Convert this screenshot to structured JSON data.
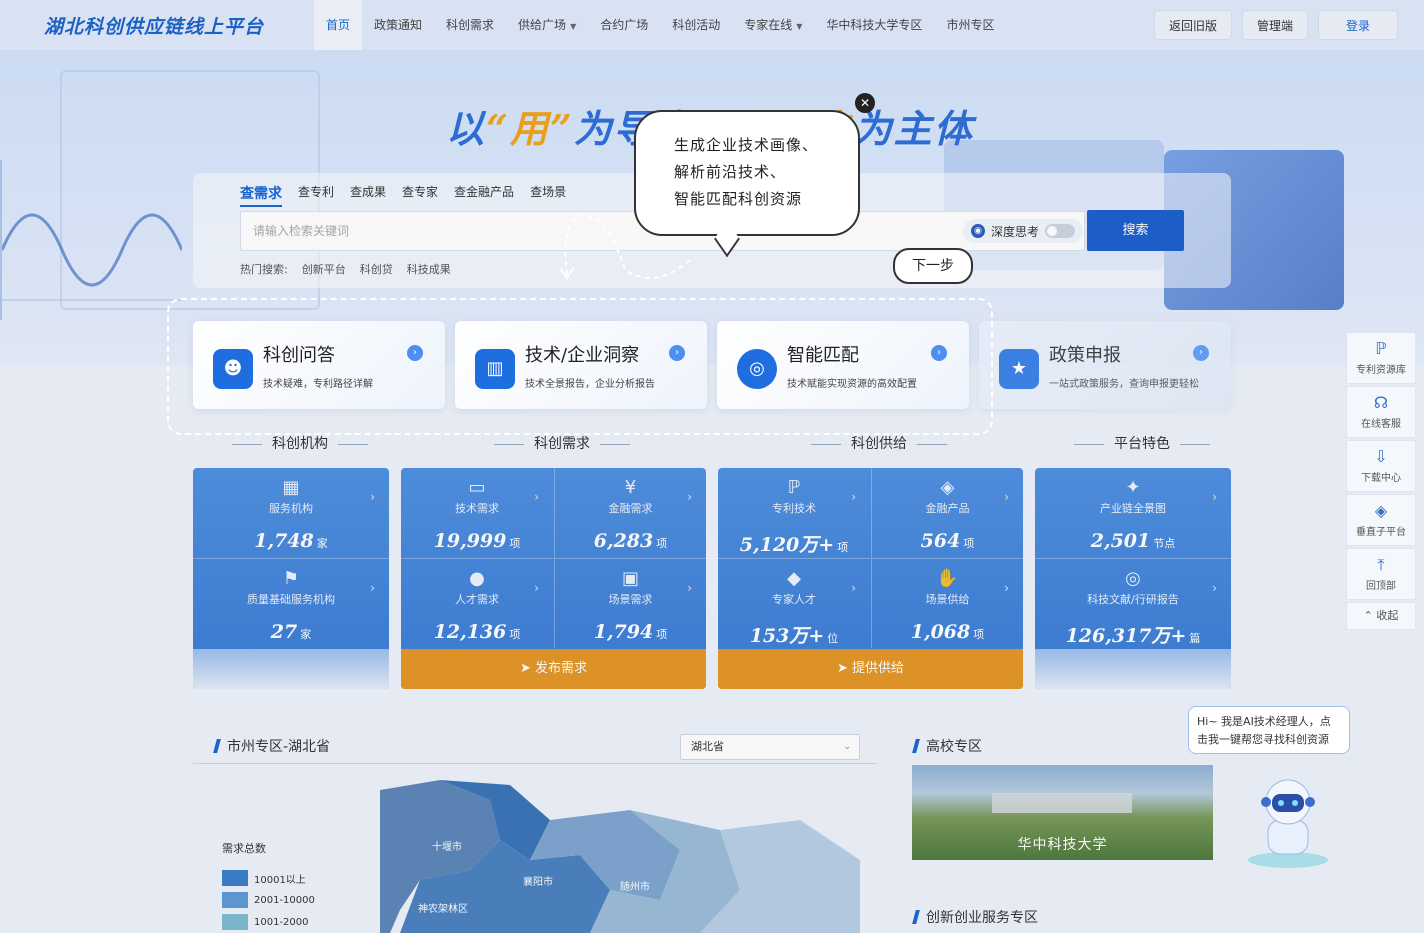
{
  "nav": {
    "logo": "湖北科创供应链线上平台",
    "menu": [
      {
        "label": "首页",
        "active": true,
        "dropdown": false
      },
      {
        "label": "政策通知",
        "active": false,
        "dropdown": false
      },
      {
        "label": "科创需求",
        "active": false,
        "dropdown": false
      },
      {
        "label": "供给广场",
        "active": false,
        "dropdown": true
      },
      {
        "label": "合约广场",
        "active": false,
        "dropdown": false
      },
      {
        "label": "科创活动",
        "active": false,
        "dropdown": false
      },
      {
        "label": "专家在线",
        "active": false,
        "dropdown": true
      },
      {
        "label": "华中科技大学专区",
        "active": false,
        "dropdown": false
      },
      {
        "label": "市州专区",
        "active": false,
        "dropdown": false
      }
    ],
    "old_version": "返回旧版",
    "admin": "管理端",
    "login": "登录"
  },
  "hero": {
    "slogan_a": "以",
    "slogan_q1": "“用”",
    "slogan_b": "为导向，以",
    "slogan_c": "用户",
    "slogan_d": "为主体"
  },
  "search": {
    "tabs": [
      "查需求",
      "查专利",
      "查成果",
      "查专家",
      "查金融产品",
      "查场景"
    ],
    "active_tab": "查需求",
    "placeholder": "请输入检索关键词",
    "deep_think": "深度思考",
    "button": "搜索",
    "hot_label": "热门搜索:",
    "hot_items": [
      "创新平台",
      "科创贷",
      "科技成果"
    ]
  },
  "features": [
    {
      "title": "科创问答",
      "desc": "技术疑难，专利路径详解",
      "icon": "robot-icon"
    },
    {
      "title": "技术/企业洞察",
      "desc": "技术全景报告，企业分析报告",
      "icon": "bar-chart-icon"
    },
    {
      "title": "智能匹配",
      "desc": "技术赋能实现资源的高效配置",
      "icon": "target-icon"
    },
    {
      "title": "政策申报",
      "desc": "一站式政策服务，查询申报更轻松",
      "icon": "policy-star-icon"
    }
  ],
  "guide": {
    "bubble_lines": [
      "生成企业技术画像、",
      "解析前沿技术、",
      "智能匹配科创资源"
    ],
    "next": "下一步"
  },
  "sections": {
    "institutions": "科创机构",
    "demand": "科创需求",
    "supply": "科创供给",
    "features": "平台特色"
  },
  "stats": {
    "service_org": {
      "label": "服务机构",
      "value": "1,748",
      "unit": "家"
    },
    "quality_org": {
      "label": "质量基础服务机构",
      "value": "27",
      "unit": "家"
    },
    "tech_demand": {
      "label": "技术需求",
      "value": "19,999",
      "unit": "项"
    },
    "finance_demand": {
      "label": "金融需求",
      "value": "6,283",
      "unit": "项"
    },
    "talent_demand": {
      "label": "人才需求",
      "value": "12,136",
      "unit": "项"
    },
    "scene_demand": {
      "label": "场景需求",
      "value": "1,794",
      "unit": "项"
    },
    "patent_tech": {
      "label": "专利技术",
      "value": "5,120万+",
      "unit": "项"
    },
    "finance_product": {
      "label": "金融产品",
      "value": "564",
      "unit": "项"
    },
    "expert": {
      "label": "专家人才",
      "value": "153万+",
      "unit": "位"
    },
    "scene_supply": {
      "label": "场景供给",
      "value": "1,068",
      "unit": "项"
    },
    "chain_map": {
      "label": "产业链全景图",
      "value": "2,501",
      "unit": "节点"
    },
    "literature": {
      "label": "科技文献/行研报告",
      "value": "126,317万+",
      "unit": "篇"
    },
    "publish_demand": "发布需求",
    "provide_supply": "提供供给"
  },
  "city_panel": {
    "title": "市州专区-湖北省",
    "select_value": "湖北省",
    "legend_title": "需求总数",
    "legend": [
      {
        "label": "10001以上",
        "color": "#3a7fc8"
      },
      {
        "label": "2001-10000",
        "color": "#5e9ad6"
      },
      {
        "label": "1001-2000",
        "color": "#7fbad0"
      }
    ],
    "map_labels": [
      "十堰市",
      "襄阳市",
      "随州市",
      "神农架林区"
    ]
  },
  "college_panel": {
    "title": "高校专区",
    "campus_name": "华中科技大学"
  },
  "innovation_panel": {
    "title": "创新创业服务专区"
  },
  "sidebar": [
    {
      "label": "专利资源库",
      "icon": "patent-icon"
    },
    {
      "label": "在线客服",
      "icon": "headset-icon"
    },
    {
      "label": "下载中心",
      "icon": "download-icon"
    },
    {
      "label": "垂直子平台",
      "icon": "layers-icon"
    },
    {
      "label": "回顶部",
      "icon": "to-top-icon"
    }
  ],
  "sidebar_collapse": "收起",
  "ai_assistant": {
    "text": "Hi~ 我是AI技术经理人，点击我一键帮您寻找科创资源"
  }
}
